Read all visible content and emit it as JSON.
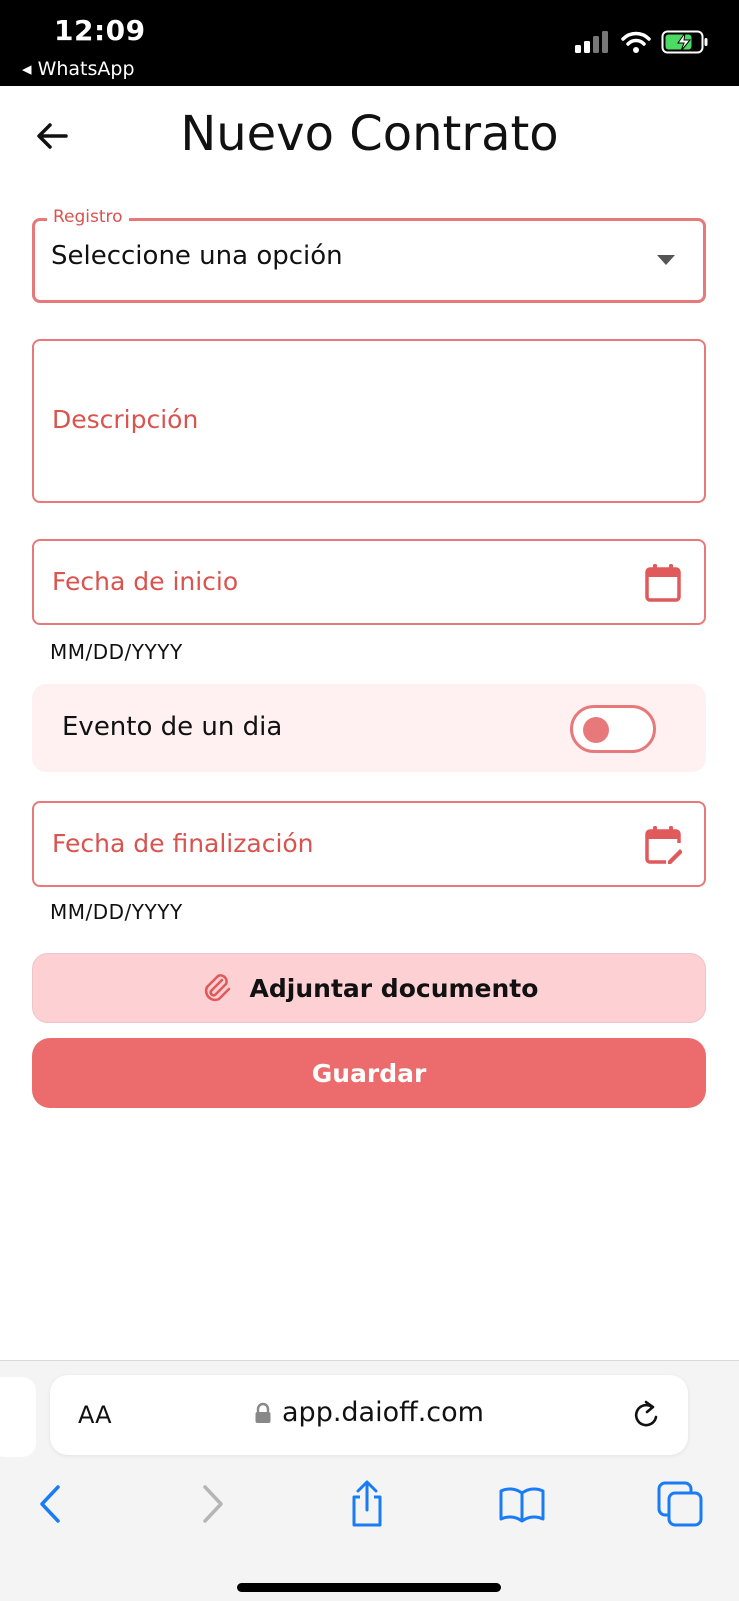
{
  "status_bar": {
    "time": "12:09",
    "back_app": "◂ WhatsApp"
  },
  "header": {
    "title": "Nuevo Contrato"
  },
  "form": {
    "registro": {
      "legend": "Registro",
      "value": "Seleccione una opción"
    },
    "descripcion": {
      "placeholder": "Descripción"
    },
    "fecha_inicio": {
      "placeholder": "Fecha de inicio",
      "helper": "MM/DD/YYYY"
    },
    "evento": {
      "label": "Evento de un dia",
      "on": false
    },
    "fecha_fin": {
      "placeholder": "Fecha de finalización",
      "helper": "MM/DD/YYYY"
    },
    "attach_label": "Adjuntar documento",
    "save_label": "Guardar"
  },
  "browser": {
    "aa_label": "AA",
    "url": "app.daioff.com"
  },
  "colors": {
    "accent": "#ec6b6c",
    "border": "#e8797a",
    "placeholder": "#d9534f",
    "attach_bg": "#fdd0d3",
    "toggle_row_bg": "#fff1f1",
    "ios_blue": "#1a7cf5"
  },
  "icons": [
    "back-arrow-icon",
    "calendar-icon",
    "calendar-edit-icon",
    "paperclip-icon",
    "lock-icon",
    "reload-icon",
    "share-icon",
    "bookmarks-icon",
    "tabs-icon"
  ]
}
